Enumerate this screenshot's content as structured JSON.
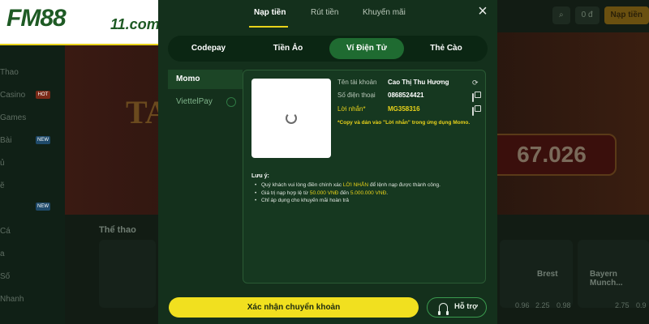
{
  "logo": {
    "main": "FM88",
    "sub": "11.com"
  },
  "background": {
    "sidebar_items": [
      "Thao",
      "Casino",
      "Games",
      "Bài",
      "ủ",
      "ẽ",
      "Cá",
      "a",
      "Số",
      "Nhanh"
    ],
    "banner_big": "TA",
    "jackpot": "67.026",
    "section_title": "Thể thao",
    "balance_btn": "0 đ",
    "deposit_btn": "Nạp tiền",
    "teams": [
      "Brest",
      "Bayern Munch..."
    ],
    "odds": [
      "0.96",
      "2.25",
      "0.98",
      "2.75",
      "0.9"
    ],
    "badges": [
      "HOT",
      "NEW",
      "NEW"
    ]
  },
  "modal": {
    "tabs": [
      {
        "label": "Nạp tiền",
        "active": true
      },
      {
        "label": "Rút tiền",
        "active": false
      },
      {
        "label": "Khuyến mãi",
        "active": false
      }
    ],
    "close_icon": "×",
    "methods": [
      {
        "label": "Codepay",
        "active": false
      },
      {
        "label": "Tiền Ảo",
        "active": false
      },
      {
        "label": "Ví Điện Tử",
        "active": true
      },
      {
        "label": "Thẻ Cào",
        "active": false
      }
    ],
    "wallets": [
      {
        "label": "Momo",
        "active": true
      },
      {
        "label": "ViettelPay",
        "active": false
      }
    ],
    "account": {
      "name_label": "Tên tài khoản",
      "name_value": "Cao Thị Thu Hương",
      "phone_label": "Số điện thoại",
      "phone_value": "0868524421",
      "message_label": "Lời nhắn*",
      "message_value": "MG358316",
      "note": "*Copy và dán vào \"Lời nhắn\" trong ứng dụng Momo."
    },
    "notice": {
      "title": "Lưu ý:",
      "line1_pre": "Quý khách vui lòng điền chính xác ",
      "line1_hl": "LỜI NHẮN",
      "line1_post": " để lệnh nạp được thành công.",
      "line2_pre": "Giá trị nạp hợp lệ từ ",
      "line2_hl1": "50.000 VNĐ",
      "line2_mid": " đến ",
      "line2_hl2": "5.000.000 VNĐ",
      "line2_post": ".",
      "line3": "Chỉ áp dụng cho khuyến mãi hoàn trả"
    },
    "confirm_label": "Xác nhận chuyển khoản",
    "support_label": "Hỗ trợ"
  },
  "colors": {
    "accent_yellow": "#f1e01f",
    "modal_bg": "#14301c",
    "active_tab_green": "#1f6b31"
  }
}
